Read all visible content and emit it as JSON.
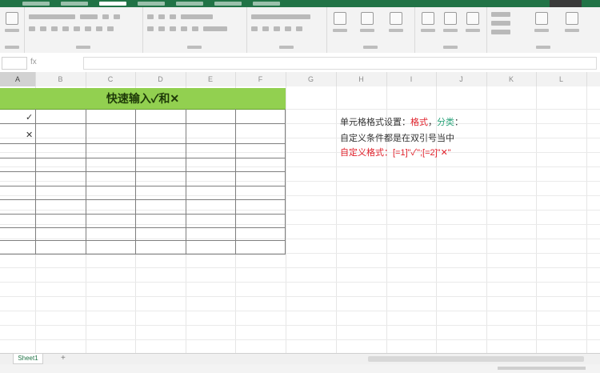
{
  "table": {
    "title": "快速输入✓和✕",
    "marks": [
      "✓",
      "✕"
    ]
  },
  "notes": {
    "line1_prefix": "单元格格式设置：",
    "line1_red": "格式",
    "line1_sep1": "，",
    "line1_green": "分类",
    "line1_tail": "：",
    "line2": "自定义条件都是在双引号当中",
    "line3": "自定义格式：[=1]\"✓\";[=2]\"✕\""
  },
  "sheet": {
    "tab_label": "Sheet1",
    "add_label": "+"
  },
  "formula_bar": {
    "fx_label": "fx"
  },
  "colors": {
    "accent": "#217346",
    "header_fill": "#92d050",
    "note_red": "#e0202a",
    "note_green": "#2aa37a"
  }
}
